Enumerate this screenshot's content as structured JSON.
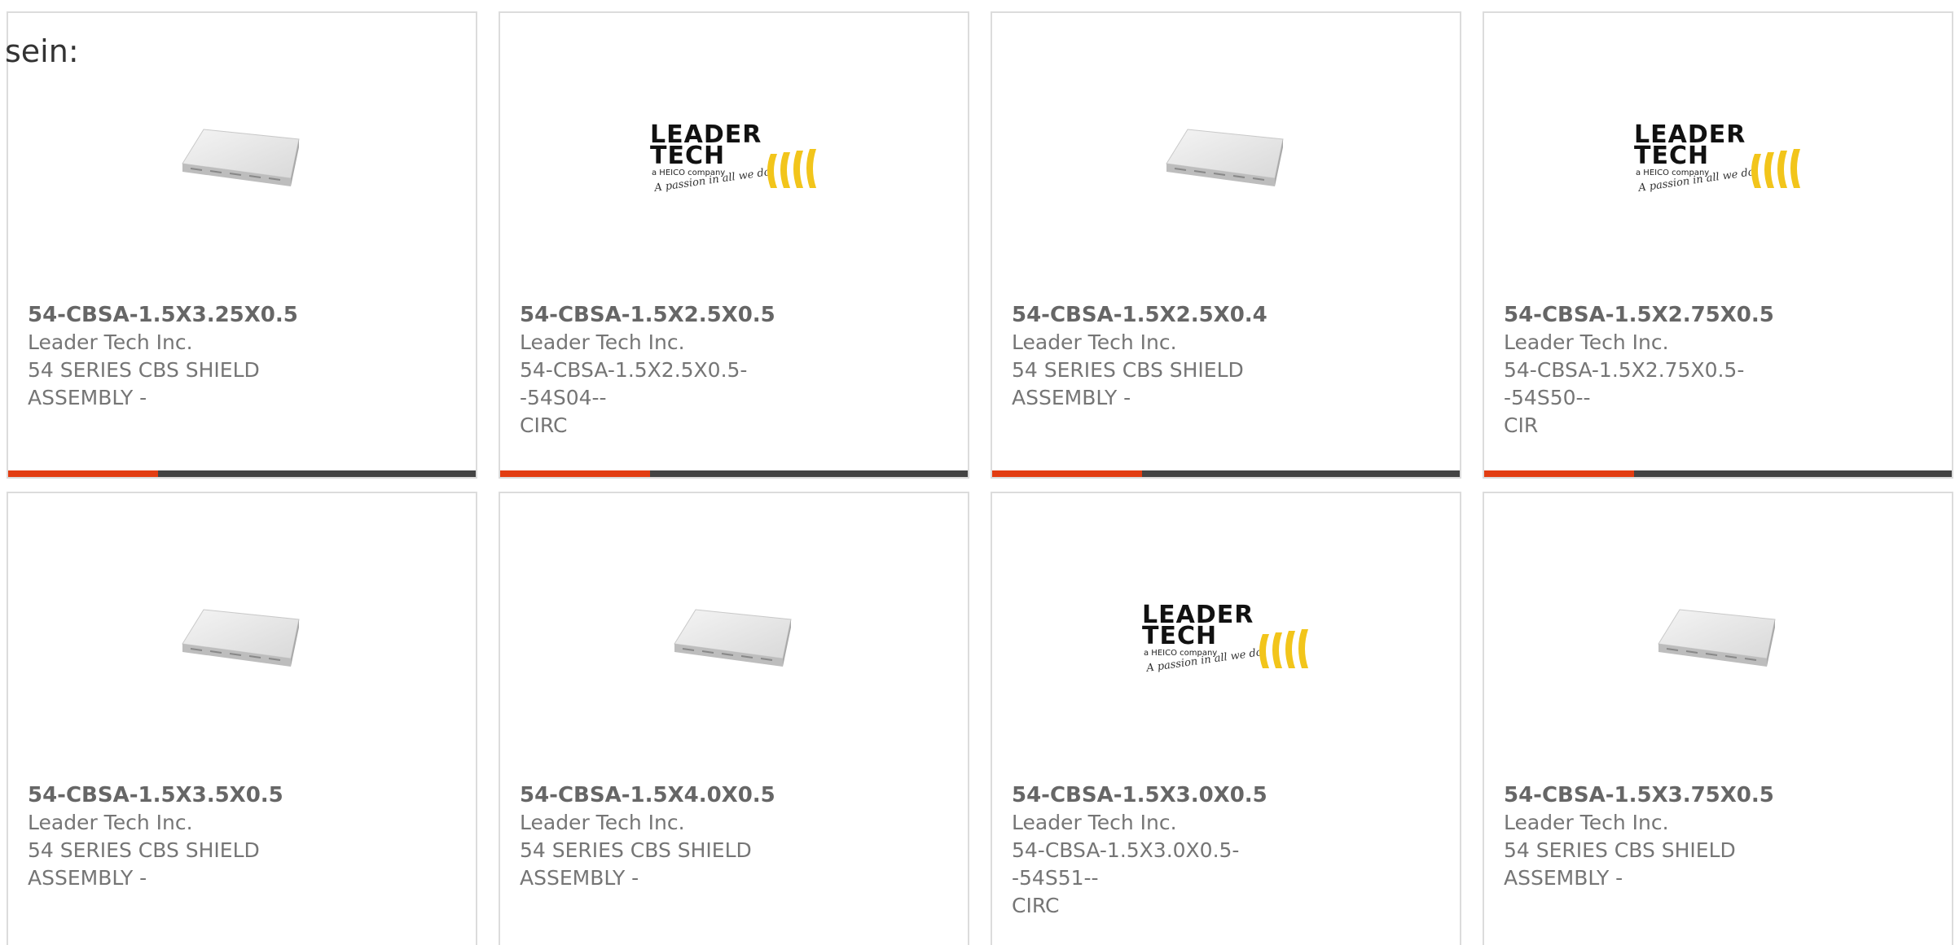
{
  "page": {
    "heading": "sein:"
  },
  "colors": {
    "accent": "#e23d12",
    "bar": "#444444",
    "border": "#dcdcdc",
    "logo_yellow": "#f2c51b"
  },
  "products": [
    {
      "part_number": "54-CBSA-1.5X3.25X0.5",
      "manufacturer": "Leader Tech Inc.",
      "description_lines": [
        "54 SERIES CBS SHIELD",
        "ASSEMBLY -"
      ],
      "image": "shield-product-image"
    },
    {
      "part_number": "54-CBSA-1.5X2.5X0.5",
      "manufacturer": "Leader Tech Inc.",
      "description_lines": [
        "54-CBSA-1.5X2.5X0.5--54S04--",
        "CIRC"
      ],
      "image": "leader-tech-logo"
    },
    {
      "part_number": "54-CBSA-1.5X2.5X0.4",
      "manufacturer": "Leader Tech Inc.",
      "description_lines": [
        "54 SERIES CBS SHIELD",
        "ASSEMBLY -"
      ],
      "image": "shield-product-image"
    },
    {
      "part_number": "54-CBSA-1.5X2.75X0.5",
      "manufacturer": "Leader Tech Inc.",
      "description_lines": [
        "54-CBSA-1.5X2.75X0.5--54S50--",
        "CIR"
      ],
      "image": "leader-tech-logo"
    },
    {
      "part_number": "54-CBSA-1.5X3.5X0.5",
      "manufacturer": "Leader Tech Inc.",
      "description_lines": [
        "54 SERIES CBS SHIELD",
        "ASSEMBLY -"
      ],
      "image": "shield-product-image"
    },
    {
      "part_number": "54-CBSA-1.5X4.0X0.5",
      "manufacturer": "Leader Tech Inc.",
      "description_lines": [
        "54 SERIES CBS SHIELD",
        "ASSEMBLY -"
      ],
      "image": "shield-product-image"
    },
    {
      "part_number": "54-CBSA-1.5X3.0X0.5",
      "manufacturer": "Leader Tech Inc.",
      "description_lines": [
        "54-CBSA-1.5X3.0X0.5--54S51--",
        "CIRC"
      ],
      "image": "leader-tech-logo"
    },
    {
      "part_number": "54-CBSA-1.5X3.75X0.5",
      "manufacturer": "Leader Tech Inc.",
      "description_lines": [
        "54 SERIES CBS SHIELD",
        "ASSEMBLY -"
      ],
      "image": "shield-product-image"
    }
  ],
  "logo": {
    "line1": "LEADER",
    "line2": "TECH",
    "tagline": "a HEICO company",
    "slogan": "A passion in all we do"
  }
}
